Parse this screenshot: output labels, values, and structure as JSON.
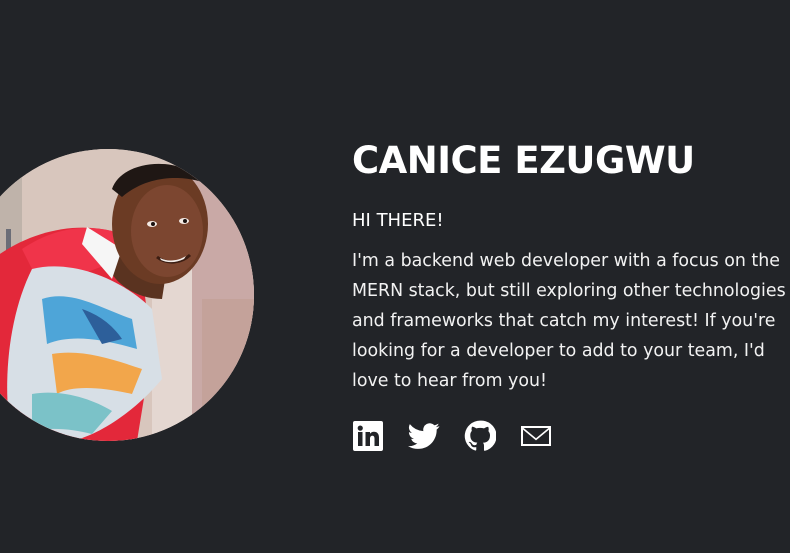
{
  "profile": {
    "name": "CANICE EZUGWU",
    "greeting": "HI THERE!",
    "bio": "I'm a backend web developer with a focus on the MERN stack, but still exploring other technologies and frameworks that catch my interest! If you're looking for a developer to add to your team, I'd love to hear from you!"
  },
  "socials": [
    {
      "icon": "linkedin-icon"
    },
    {
      "icon": "twitter-icon"
    },
    {
      "icon": "github-icon"
    },
    {
      "icon": "email-icon"
    }
  ],
  "colors": {
    "background": "#222428",
    "text": "#ffffff"
  }
}
